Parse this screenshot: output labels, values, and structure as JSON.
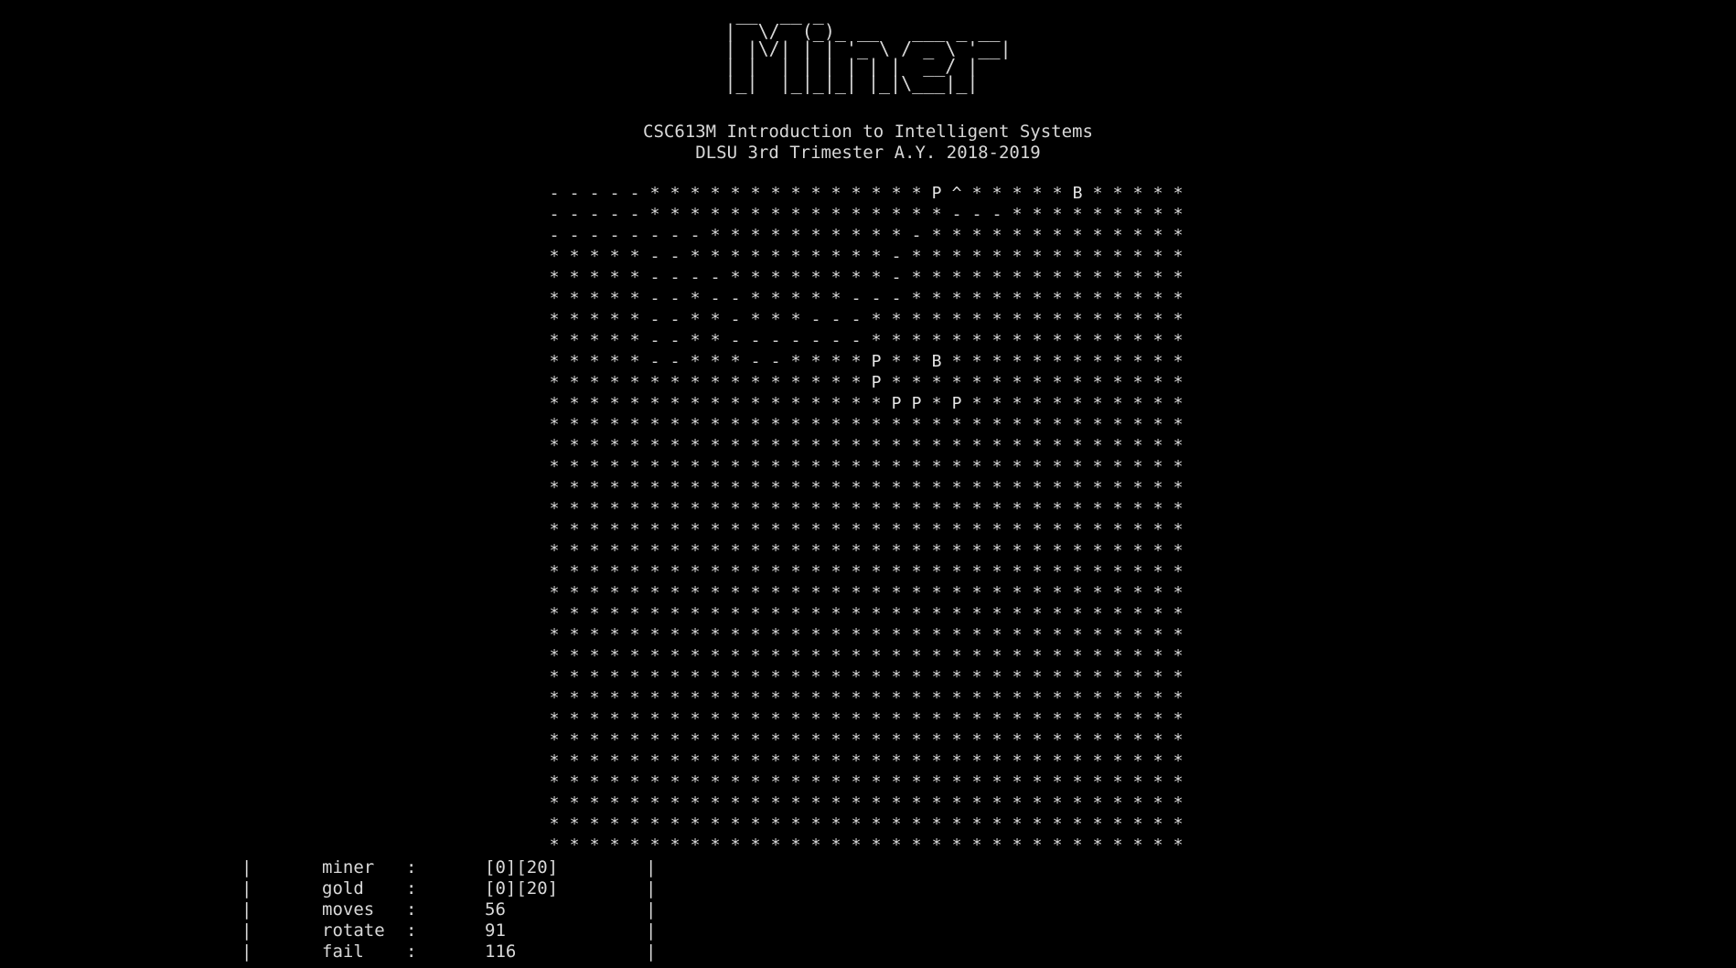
{
  "logo_ascii": " __  __ _                 \n|  \\/  (_)_ __   ___ _ __ \n| |\\/| | | '_ \\ / _ \\ '__|\n| |  | | | | | |  __/ |   \n|_|  |_|_|_| |_|\\___|_|   ",
  "header": {
    "course": "CSC613M Introduction to Intelligent Systems",
    "term": "DLSU 3rd Trimester A.Y. 2018-2019"
  },
  "grid": {
    "rows": [
      "-----**************P^*****B*****",
      "-----***************---*********",
      "--------**********-*************",
      "*****--**********-**************",
      "*****----********-**************",
      "*****--*--*****---**************",
      "*****--**-***---****************",
      "*****--**-------****************",
      "*****--***--****P**B************",
      "****************P***************",
      "*****************PP*P***********",
      "********************************",
      "********************************",
      "********************************",
      "********************************",
      "********************************",
      "********************************",
      "********************************",
      "********************************",
      "********************************",
      "********************************",
      "********************************",
      "********************************",
      "********************************",
      "********************************",
      "********************************",
      "********************************",
      "********************************",
      "********************************",
      "********************************",
      "********************************",
      "********************************"
    ]
  },
  "stats": {
    "border": "|",
    "separator": ":",
    "items": [
      {
        "label": "miner",
        "value": "[0][20]"
      },
      {
        "label": "gold",
        "value": "[0][20]"
      },
      {
        "label": "moves",
        "value": "56"
      },
      {
        "label": "rotate",
        "value": "91"
      },
      {
        "label": "fail",
        "value": "116"
      }
    ]
  },
  "footer_fragment": "- -"
}
